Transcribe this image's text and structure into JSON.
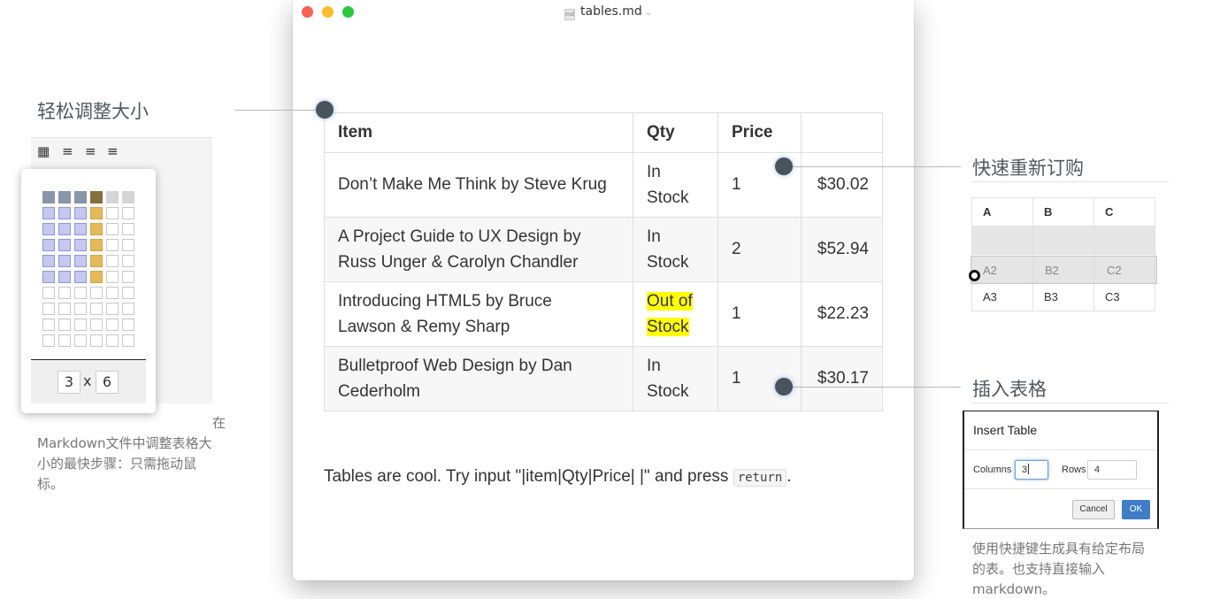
{
  "window": {
    "doc_icon": "md",
    "title": "tables.md"
  },
  "table": {
    "headers": [
      "Item",
      "Qty",
      "Price",
      ""
    ],
    "rows": [
      {
        "item_line1": "Don’t Make Me Think by Steve Krug",
        "item_line2": "",
        "qty_line1": "In",
        "qty_line2": "Stock",
        "count": "1",
        "price": "$30.02"
      },
      {
        "item_line1": "A Project Guide to UX Design by",
        "item_line2": "Russ Unger & Carolyn Chandler",
        "qty_line1": "In",
        "qty_line2": "Stock",
        "count": "2",
        "price": "$52.94"
      },
      {
        "item_line1": "Introducing HTML5 by Bruce",
        "item_line2": "Lawson & Remy Sharp",
        "qty_line1": "Out of",
        "qty_line2": "Stock",
        "count": "1",
        "price": "$22.23"
      },
      {
        "item_line1": "Bulletproof Web Design by Dan",
        "item_line2": "Cederholm",
        "qty_line1": "In",
        "qty_line2": "Stock",
        "count": "1",
        "price": "$30.17"
      }
    ]
  },
  "body": {
    "text_before": "Tables are cool. Try input \"|item|Qty|Price| |\" and press ",
    "code": "return",
    "text_after": "."
  },
  "left_panel": {
    "heading": "轻松调整大小",
    "toolbar_icons": [
      "table-grid-icon",
      "align-left-icon",
      "align-center-icon",
      "align-right-icon"
    ],
    "size_cols": "3",
    "size_x": "x",
    "size_rows": "6",
    "caption_line1": "在",
    "caption_line2": "Markdown文件中调整表格大",
    "caption_line3": "小的最快步骤：只需拖动鼠",
    "caption_line4": "标。"
  },
  "right_top": {
    "heading": "快速重新订购",
    "headers": [
      "A",
      "B",
      "C"
    ],
    "dragging_row": [
      "A2",
      "B2",
      "C2"
    ],
    "row3": [
      "A3",
      "B3",
      "C3"
    ]
  },
  "right_bottom": {
    "heading": "插入表格",
    "dialog_title": "Insert Table",
    "columns_label": "Columns",
    "columns_value": "3",
    "rows_label": "Rows",
    "rows_value": "4",
    "cancel_label": "Cancel",
    "ok_label": "OK",
    "caption_line1": "使用快捷键生成具有给定布局",
    "caption_line2": "的表。也支持直接输入",
    "caption_line3": "markdown。"
  },
  "colors": {
    "highlight": "#ffff00",
    "ok_button": "#3f7dc6",
    "annotation_dot": "#48535c"
  }
}
